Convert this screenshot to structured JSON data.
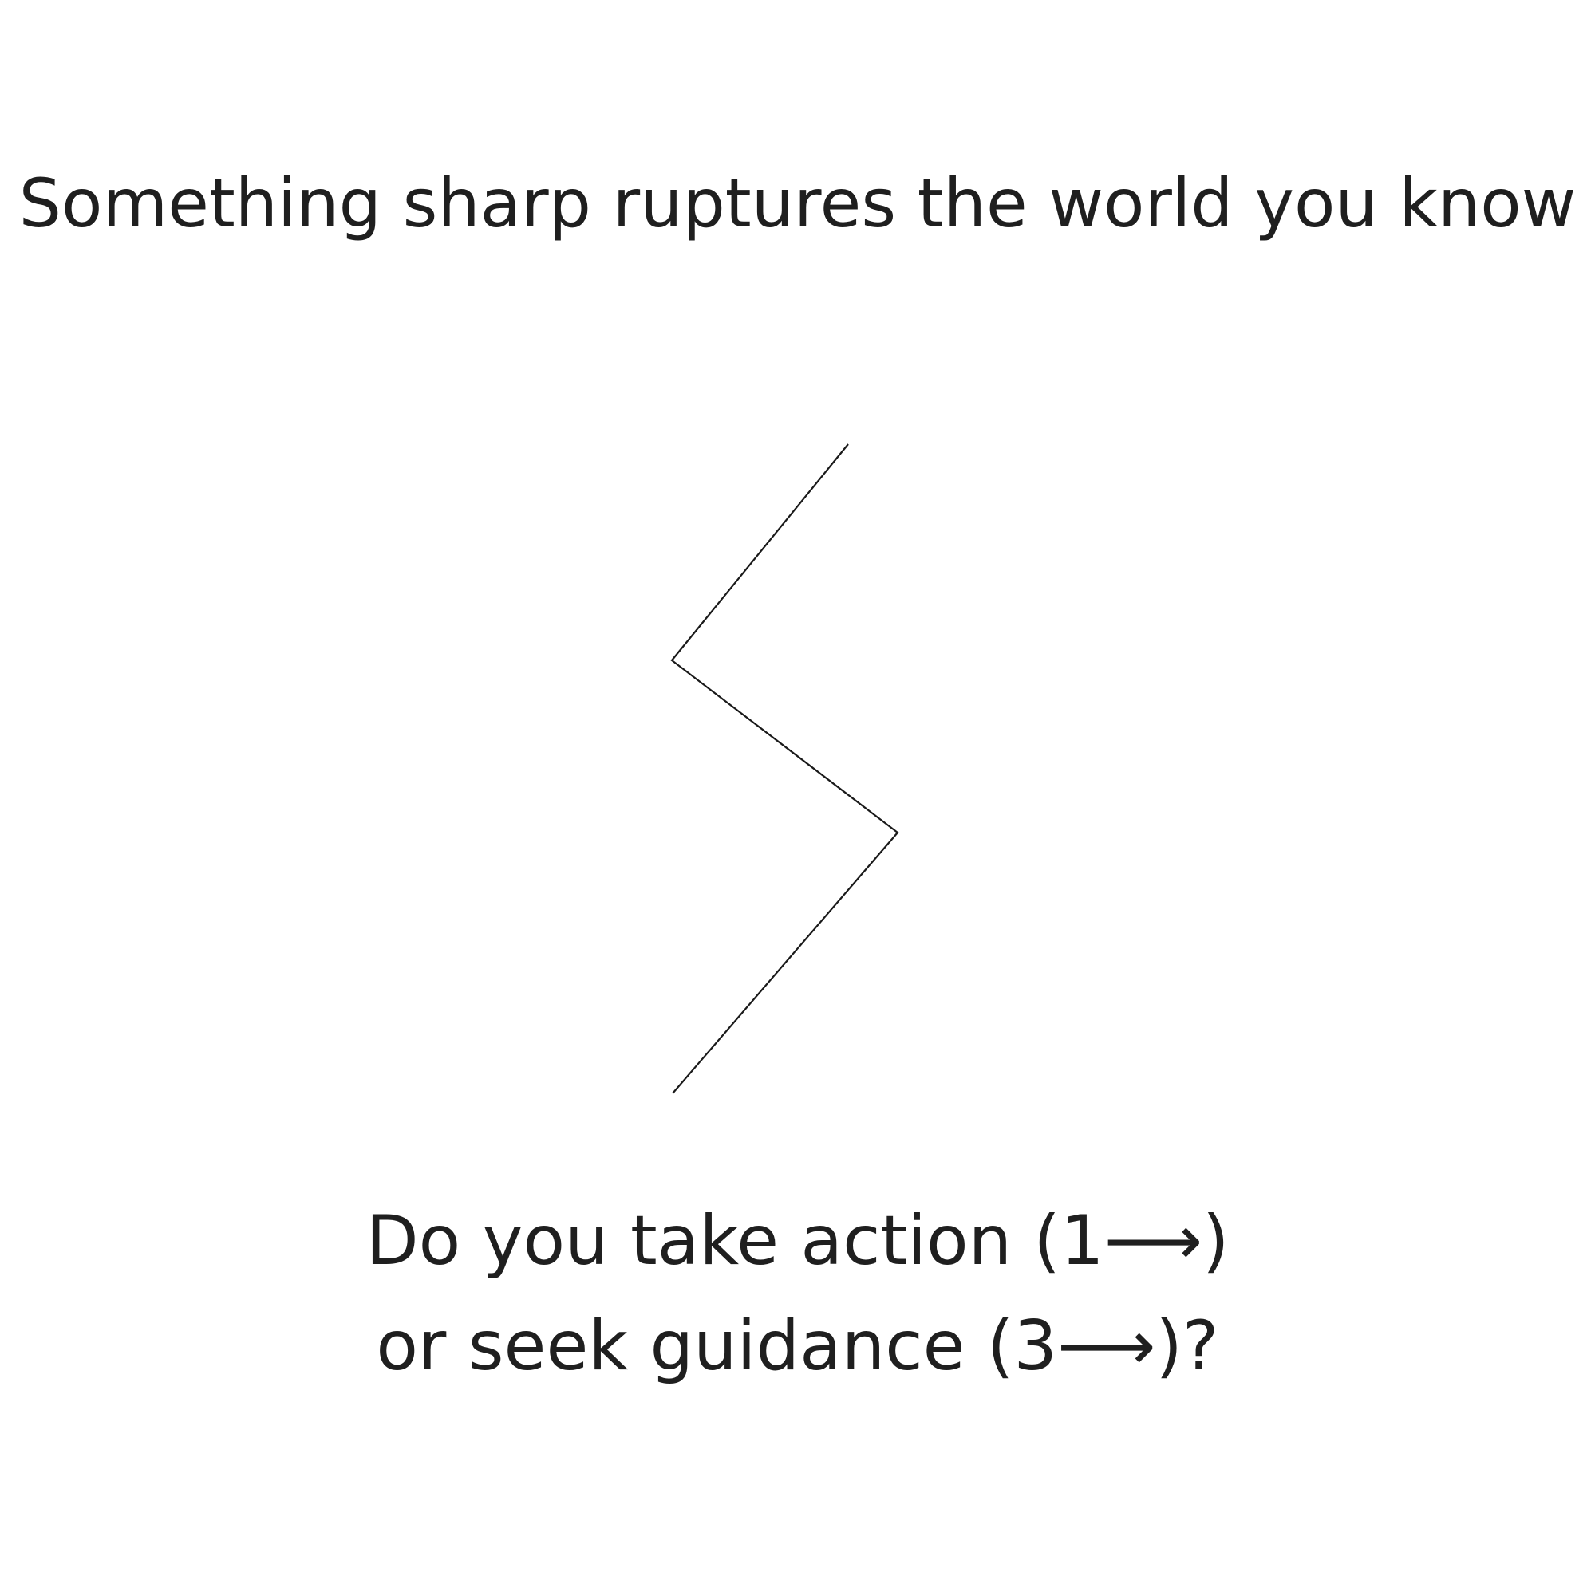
{
  "scene": {
    "headline": "Something sharp ruptures the world you know",
    "illustration_icon": "zigzag-crack-icon"
  },
  "prompt": {
    "line1": "Do you take action (1⟶)",
    "line2": "or seek guidance (3⟶)?"
  },
  "colors": {
    "background": "#ffffff",
    "text": "#1f1f1f",
    "line": "#1a1a1a"
  }
}
